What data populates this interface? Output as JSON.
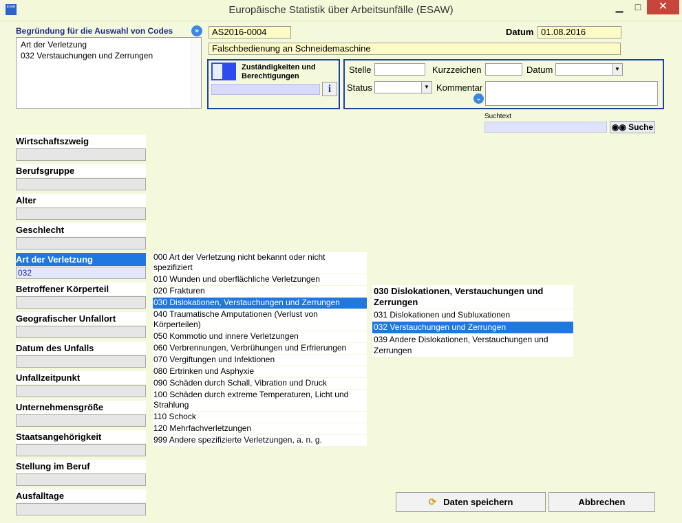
{
  "window": {
    "title": "Europäische Statistik über Arbeitsunfälle (ESAW)",
    "app_icon": "ESAW",
    "min": "▁",
    "max": "□",
    "close": "✕"
  },
  "reason": {
    "label": "Begründung für die Auswahl von Codes",
    "lines": [
      "Art der Verletzung",
      "032 Verstauchungen und Zerrungen"
    ]
  },
  "case": {
    "number": "AS2016-0004",
    "date_label": "Datum",
    "date_value": "01.08.2016",
    "description": "Falschbedienung an Schneidemaschine"
  },
  "responsibilities": {
    "title": "Zuständigkeiten und Berechtigungen",
    "info": "i"
  },
  "status_panel": {
    "stelle_label": "Stelle",
    "kurz_label": "Kurzzeichen",
    "datum_label": "Datum",
    "status_label": "Status",
    "kommentar_label": "Kommentar"
  },
  "search": {
    "label": "Suchtext",
    "button": "Suche"
  },
  "categories": [
    {
      "title": "Wirtschaftszweig",
      "value": ""
    },
    {
      "title": "Berufsgruppe",
      "value": ""
    },
    {
      "title": "Alter",
      "value": ""
    },
    {
      "title": "Geschlecht",
      "value": ""
    },
    {
      "title": "Art der Verletzung",
      "value": "032"
    },
    {
      "title": "Betroffener Körperteil",
      "value": ""
    },
    {
      "title": "Geografischer Unfallort",
      "value": ""
    },
    {
      "title": "Datum des Unfalls",
      "value": ""
    },
    {
      "title": "Unfallzeitpunkt",
      "value": ""
    },
    {
      "title": "Unternehmensgröße",
      "value": ""
    },
    {
      "title": "Staatsangehörigkeit",
      "value": ""
    },
    {
      "title": "Stellung im Beruf",
      "value": ""
    },
    {
      "title": "Ausfalltage",
      "value": ""
    }
  ],
  "selected_category": 4,
  "codes": [
    "000 Art der Verletzung nicht bekannt oder nicht spezifiziert",
    "010 Wunden und oberflächliche Verletzungen",
    "020 Frakturen",
    "030 Dislokationen, Verstauchungen und Zerrungen",
    "040 Traumatische Amputationen (Verlust von Körperteilen)",
    "050 Kommotio und innere Verletzungen",
    "060 Verbrennungen, Verbrühungen und Erfrierungen",
    "070 Vergiftungen und Infektionen",
    "080 Ertrinken und Asphyxie",
    "090 Schäden durch Schall, Vibration und Druck",
    "100 Schäden durch extreme Temperaturen, Licht und Strahlung",
    "110 Schock",
    "120 Mehrfachverletzungen",
    "999 Andere spezifizierte Verletzungen, a. n. g."
  ],
  "selected_code": 3,
  "subcodes": {
    "heading": "030 Dislokationen, Verstauchungen und Zerrungen",
    "items": [
      "031 Dislokationen und Subluxationen",
      "032 Verstauchungen und Zerrungen",
      "039 Andere Dislokationen, Verstauchungen und Zerrungen"
    ],
    "selected": 1
  },
  "buttons": {
    "save": "Daten speichern",
    "cancel": "Abbrechen"
  }
}
